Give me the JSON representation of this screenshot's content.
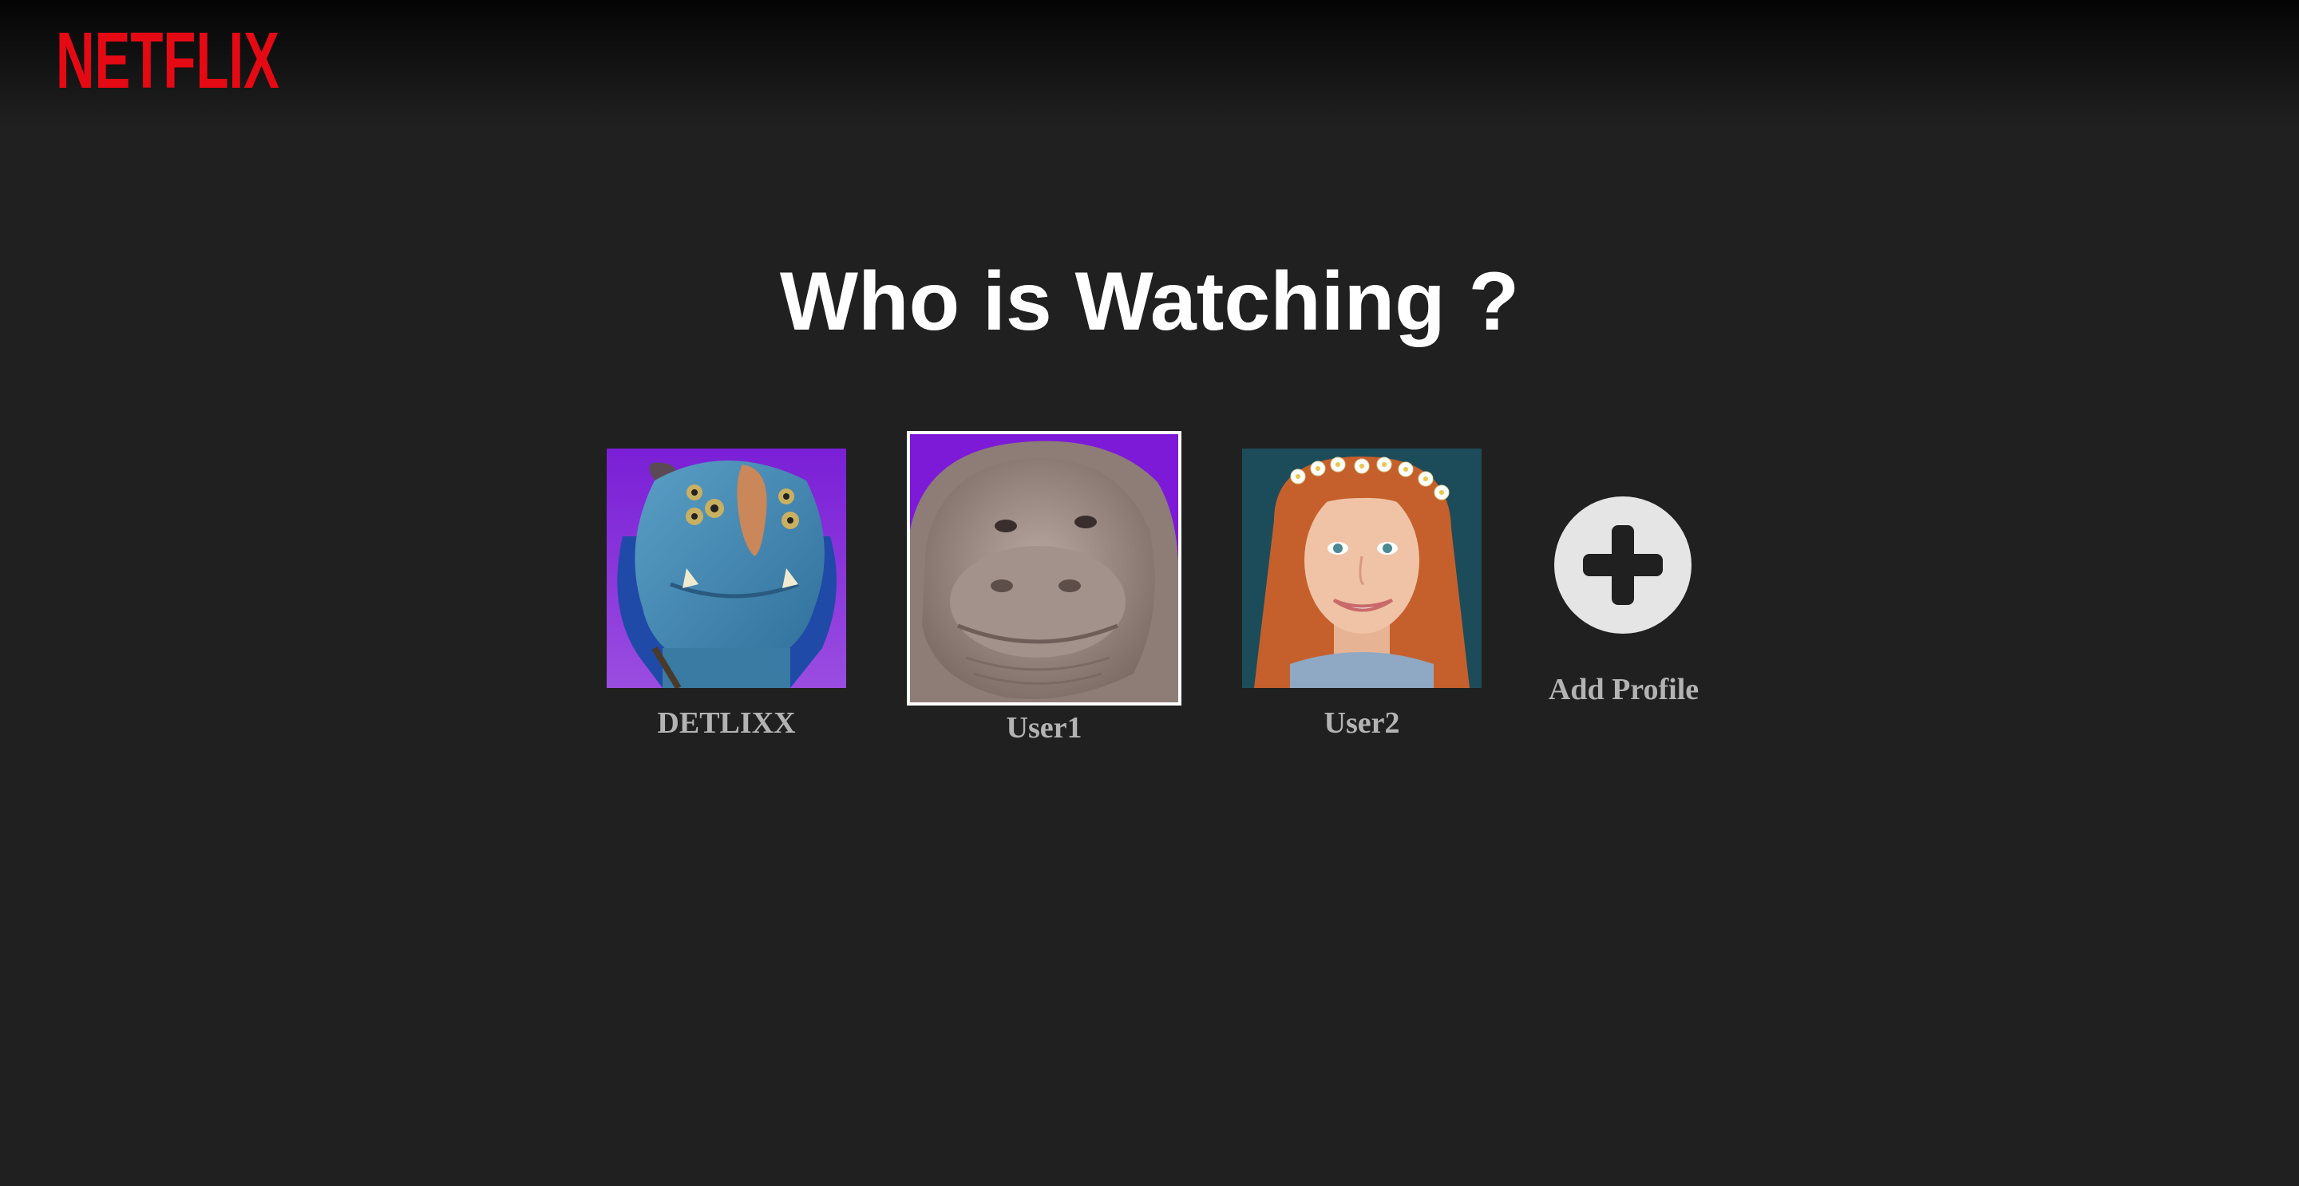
{
  "brand": {
    "name": "NETFLIX",
    "color": "#e50914"
  },
  "page": {
    "title": "Who is Watching ?",
    "background": "#202020"
  },
  "profiles": [
    {
      "name": "DETLIXX",
      "avatar": "blue-troll-avatar",
      "selected": false
    },
    {
      "name": "User1",
      "avatar": "hippo-creature-avatar",
      "selected": true
    },
    {
      "name": "User2",
      "avatar": "red-haired-woman-avatar",
      "selected": false
    }
  ],
  "add_profile": {
    "label": "Add Profile",
    "icon": "plus-icon"
  }
}
